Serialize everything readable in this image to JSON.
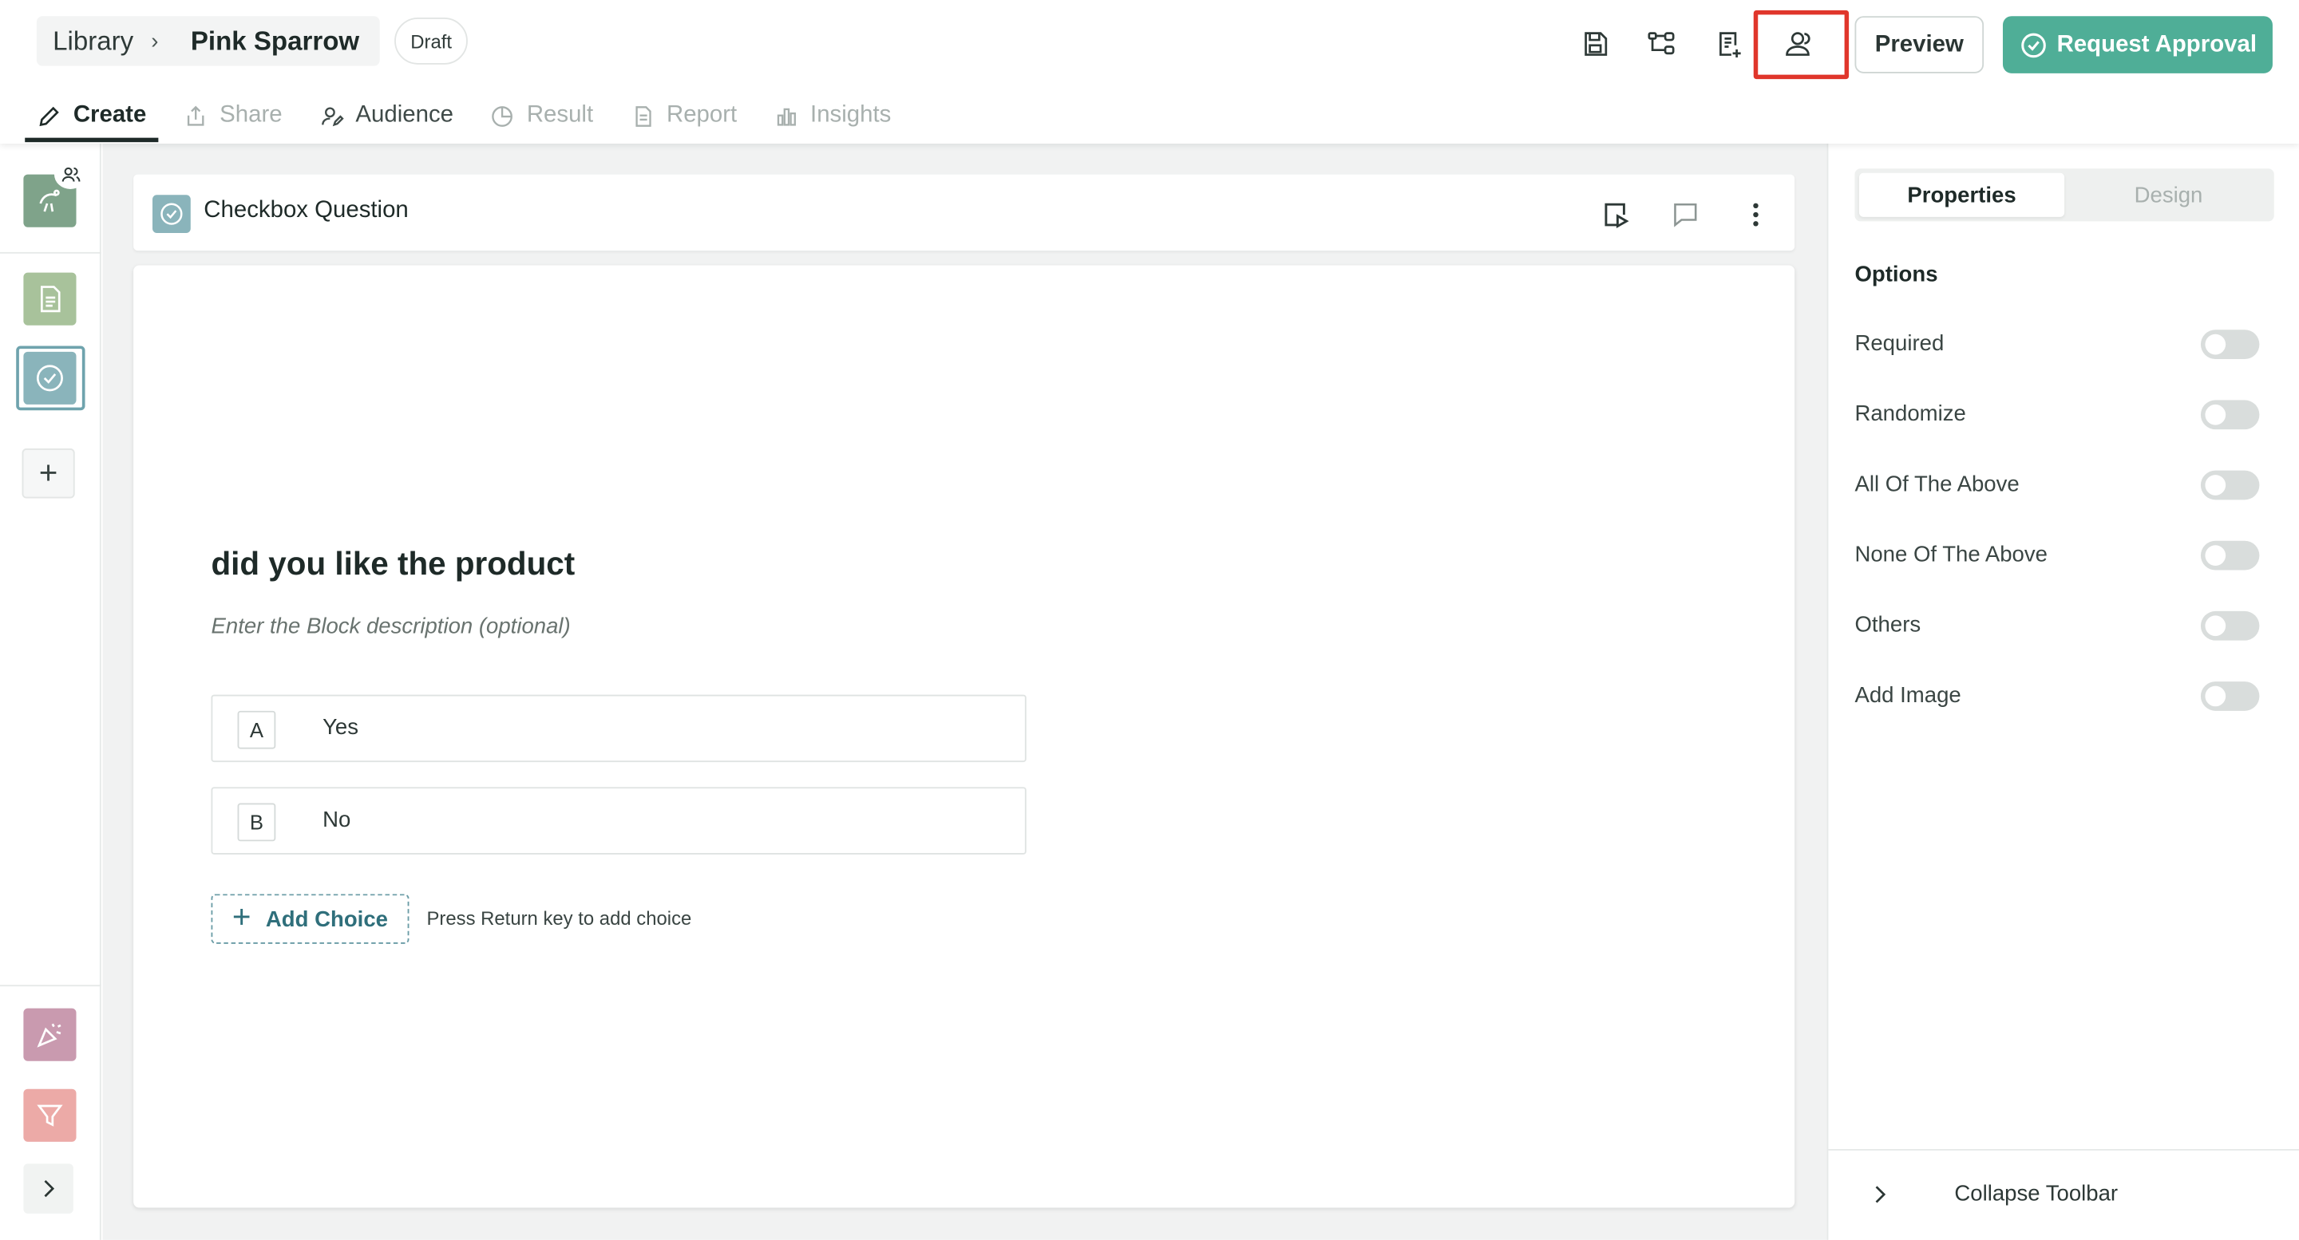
{
  "header": {
    "breadcrumb": {
      "root": "Library",
      "separator": "›",
      "current": "Pink Sparrow"
    },
    "status_badge": "Draft",
    "toolbar_icons": [
      "save-icon",
      "flow-icon",
      "add-note-icon",
      "audience-icon"
    ],
    "preview_label": "Preview",
    "approval_label": "Request Approval",
    "accent_color": "#4fae97",
    "highlight_color": "#e0362b"
  },
  "tabs": [
    {
      "label": "Create",
      "icon": "pencil-icon",
      "state": "active"
    },
    {
      "label": "Share",
      "icon": "share-icon",
      "state": "disabled"
    },
    {
      "label": "Audience",
      "icon": "audience-edit-icon",
      "state": "enabled"
    },
    {
      "label": "Result",
      "icon": "pie-icon",
      "state": "disabled"
    },
    {
      "label": "Report",
      "icon": "document-icon",
      "state": "disabled"
    },
    {
      "label": "Insights",
      "icon": "bar-chart-icon",
      "state": "disabled"
    }
  ],
  "left_rail": {
    "items": [
      "welcome-screen-icon",
      "text-block-icon",
      "checkbox-block-icon"
    ],
    "add_label": "+",
    "bottom_items": [
      "end-screen-icon",
      "filter-icon"
    ]
  },
  "question": {
    "type_label": "Checkbox Question",
    "title": "did you like the product",
    "description_placeholder": "Enter the Block description (optional)",
    "choices": [
      {
        "key": "A",
        "label": "Yes"
      },
      {
        "key": "B",
        "label": "No"
      }
    ],
    "add_choice_label": "Add Choice",
    "add_choice_hint": "Press Return key to add choice"
  },
  "panel": {
    "tabs": {
      "active": "Properties",
      "inactive": "Design"
    },
    "options_heading": "Options",
    "options": [
      {
        "label": "Required",
        "on": false
      },
      {
        "label": "Randomize",
        "on": false
      },
      {
        "label": "All Of The Above",
        "on": false
      },
      {
        "label": "None Of The Above",
        "on": false
      },
      {
        "label": "Others",
        "on": false
      },
      {
        "label": "Add Image",
        "on": false
      }
    ],
    "collapse_label": "Collapse Toolbar"
  }
}
